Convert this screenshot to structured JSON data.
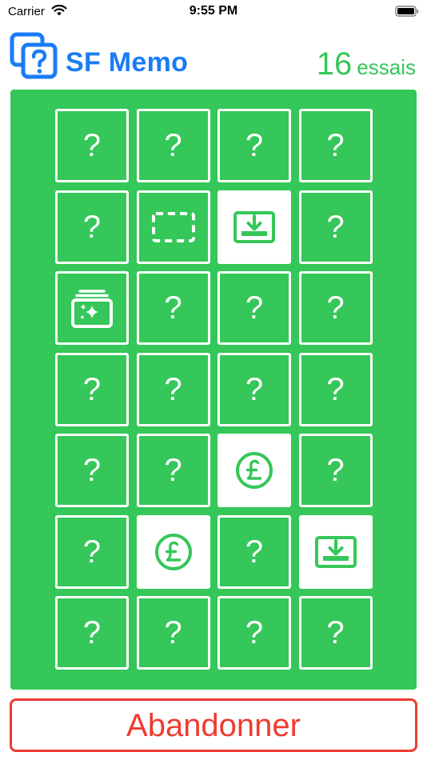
{
  "status_bar": {
    "carrier": "Carrier",
    "time": "9:55 PM"
  },
  "header": {
    "title": "SF Memo",
    "tries_count": "16",
    "tries_label": "essais"
  },
  "colors": {
    "board": "#35c759",
    "title": "#1a7cf5",
    "danger": "#ef3b31",
    "card_border": "#ffffff"
  },
  "board": {
    "columns": 4,
    "rows": [
      [
        "hidden",
        "hidden",
        "hidden",
        "hidden"
      ],
      [
        "hidden",
        "dashed-rectangle-icon",
        "download-tray-icon",
        "hidden"
      ],
      [
        "photo-stack-sparkle-icon",
        "hidden",
        "hidden",
        "hidden"
      ],
      [
        "hidden",
        "hidden",
        "hidden",
        "hidden"
      ],
      [
        "hidden",
        "hidden",
        "pound-circle-icon",
        "hidden"
      ],
      [
        "hidden",
        "pound-circle-icon",
        "hidden",
        "download-tray-icon"
      ],
      [
        "hidden",
        "hidden",
        "hidden",
        "hidden"
      ]
    ],
    "revealed_background": {
      "download-tray-icon": true,
      "pound-circle-icon": true,
      "dashed-rectangle-icon": false,
      "photo-stack-sparkle-icon": false
    },
    "hidden_symbol": "?"
  },
  "footer": {
    "abandon_label": "Abandonner"
  }
}
